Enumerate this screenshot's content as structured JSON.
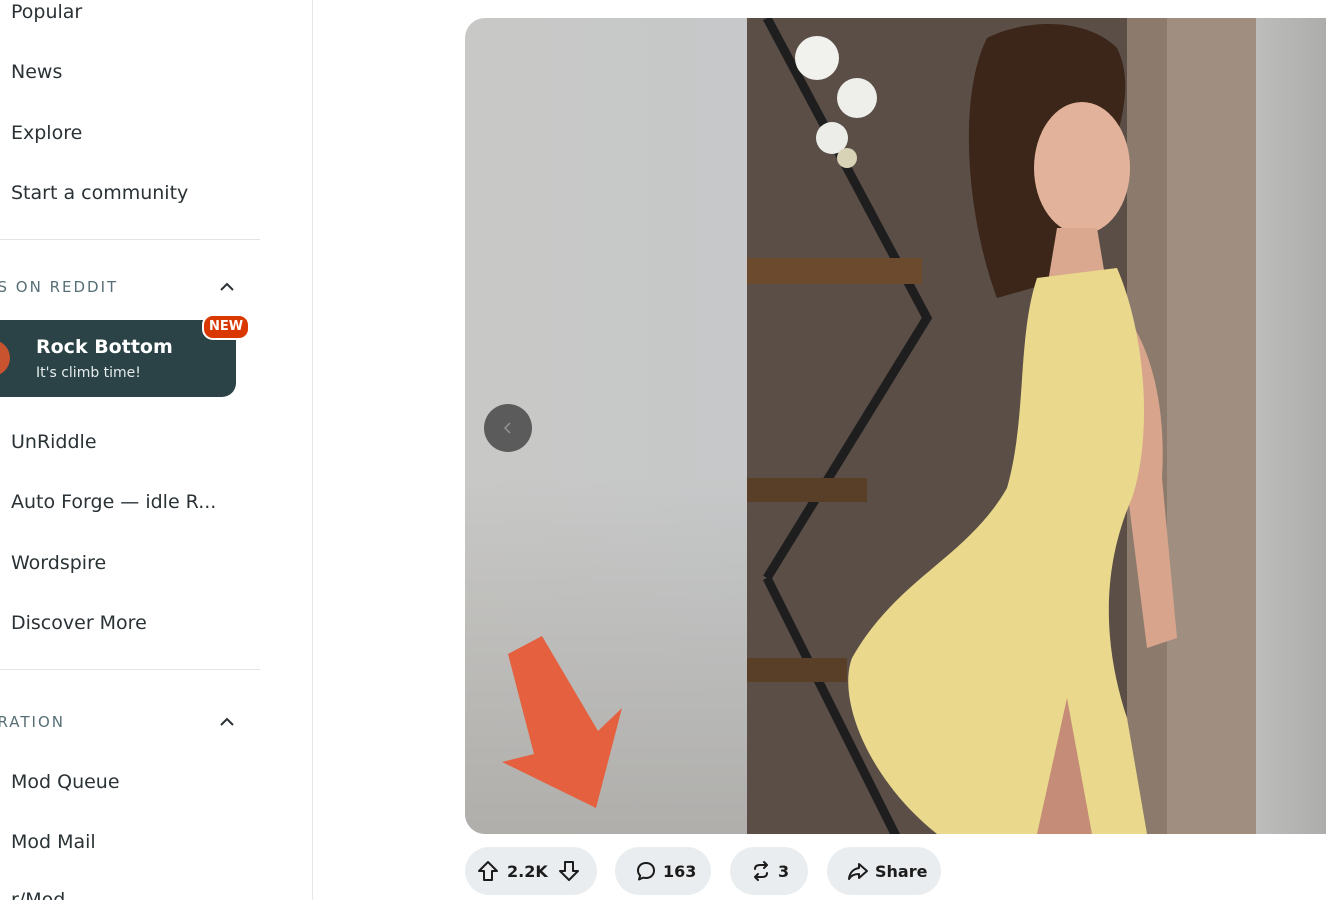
{
  "sidebar": {
    "nav": {
      "popular": "Popular",
      "news": "News",
      "explore": "Explore",
      "start_community": "Start a community"
    },
    "games_section": {
      "header": "ES ON REDDIT",
      "promo": {
        "title": "Rock Bottom",
        "subtitle": "It's climb time!",
        "badge": "NEW"
      },
      "items": [
        "UnRiddle",
        "Auto Forge — idle R...",
        "Wordspire",
        "Discover More"
      ]
    },
    "moderation_section": {
      "header": "ERATION",
      "items": [
        "Mod Queue",
        "Mod Mail",
        "r/Mod"
      ]
    }
  },
  "post": {
    "actions": {
      "score": "2.2K",
      "comments": "163",
      "crossposts": "3",
      "share": "Share"
    }
  },
  "colors": {
    "promo_bg": "#2b4346",
    "badge": "#d93900",
    "annotation_arrow": "#e4603f",
    "pill_bg": "#eaedef"
  },
  "icons": [
    "chevron-up-icon",
    "upvote-icon",
    "downvote-icon",
    "comment-icon",
    "crosspost-icon",
    "share-icon",
    "chevron-left-icon",
    "down-arrow-annotation"
  ]
}
